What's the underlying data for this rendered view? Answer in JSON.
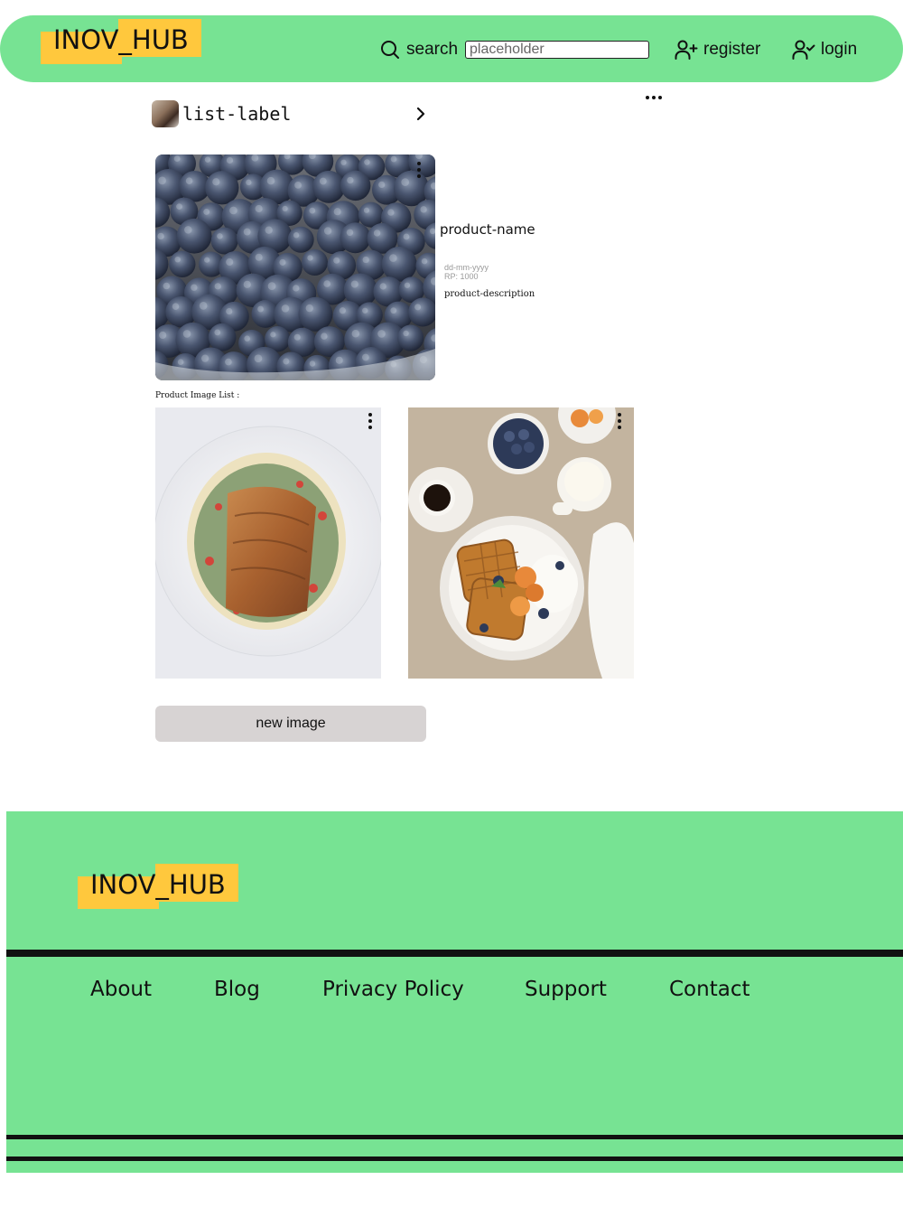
{
  "header": {
    "logo": "INOV_HUB",
    "search_label": "search",
    "search_placeholder": "placeholder",
    "register_label": "register",
    "login_label": "login"
  },
  "list": {
    "label": "list-label"
  },
  "product": {
    "name": "product-name",
    "date": "dd-mm-yyyy",
    "price": "RP:  1000",
    "description": "product-description",
    "image_list_label": "Product Image List :"
  },
  "actions": {
    "new_image_label": "new image"
  },
  "footer": {
    "logo": "INOV_HUB",
    "links": [
      "About",
      "Blog",
      "Privacy Policy",
      "Support",
      "Contact"
    ]
  },
  "colors": {
    "brand_green": "#77e393",
    "logo_yellow": "#ffc83d",
    "button_gray": "#d7d3d3"
  },
  "icons": [
    "search-icon",
    "user-plus-icon",
    "user-check-icon",
    "chevron-right-icon",
    "more-horizontal-icon",
    "more-vertical-icon"
  ]
}
